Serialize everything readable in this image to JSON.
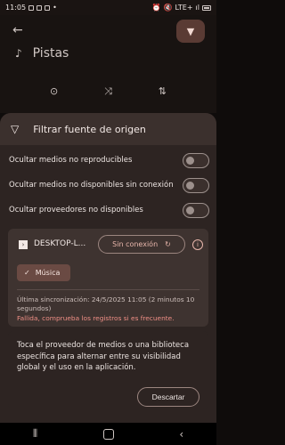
{
  "status_bar": {
    "time": "11:05",
    "network_label": "LTE+",
    "signal_text": "ıl"
  },
  "background": {
    "title": "Pistas",
    "back_icon": "arrow-left-icon",
    "filter_icon": "filter-icon",
    "toolbar_icons": [
      "play-circle-icon",
      "shuffle-icon",
      "sort-icon"
    ]
  },
  "sheet": {
    "title": "Filtrar fuente de origen",
    "toggles": [
      {
        "label": "Ocultar medios no reproducibles",
        "on": false
      },
      {
        "label": "Ocultar medios no disponibles sin conexión",
        "on": false
      },
      {
        "label": "Ocultar proveedores no disponibles",
        "on": false
      }
    ],
    "provider": {
      "name": "DESKTOP-L...",
      "status_label": "Sin conexión",
      "chip_label": "Música",
      "sync_text": "Última sincronización: 24/5/2025 11:05 (2 minutos 10 segundos)",
      "fail_text": "Fallida, comprueba los registros si es frecuente."
    },
    "hint": {
      "text": "Toca el proveedor de medios o una biblioteca específica para alternar entre su visibilidad global y el uso en la aplicación.",
      "dismiss_label": "Descartar"
    }
  },
  "colors": {
    "accent": "#e8b6ab",
    "error": "#f08f86",
    "surface": "#2d2422"
  }
}
